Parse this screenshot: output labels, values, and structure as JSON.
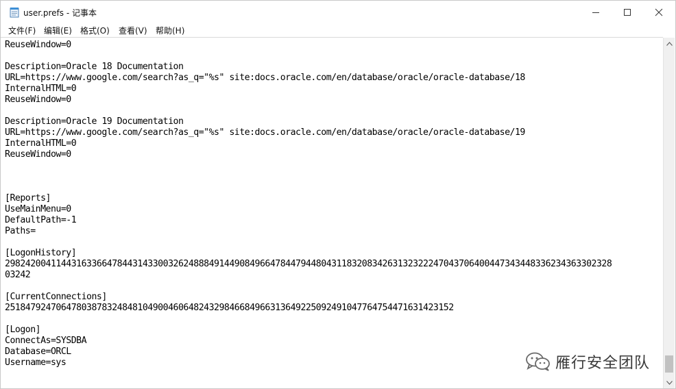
{
  "window": {
    "title": "user.prefs - 记事本"
  },
  "menu": [
    "文件(F)",
    "编辑(E)",
    "格式(O)",
    "查看(V)",
    "帮助(H)"
  ],
  "document_lines": [
    "ReuseWindow=0",
    "",
    "Description=Oracle 18 Documentation",
    "URL=https://www.google.com/search?as_q=\"%s\" site:docs.oracle.com/en/database/oracle/oracle-database/18",
    "InternalHTML=0",
    "ReuseWindow=0",
    "",
    "Description=Oracle 19 Documentation",
    "URL=https://www.google.com/search?as_q=\"%s\" site:docs.oracle.com/en/database/oracle/oracle-database/19",
    "InternalHTML=0",
    "ReuseWindow=0",
    "",
    "",
    "",
    "[Reports]",
    "UseMainMenu=0",
    "DefaultPath=-1",
    "Paths=",
    "",
    "[LogonHistory]",
    "2982420041144316336647844314330032624888491449084966478447944804311832083426313232224704370640044734344833623436330232​8",
    "03242",
    "",
    "[CurrentConnections]",
    "251847924706478038783248481049004606482432984668496631364922509249104776475447163142315​2",
    "",
    "[Logon]",
    "ConnectAs=SYSDBA",
    "Database=ORCL",
    "Username=sys"
  ],
  "watermark": {
    "text": "雁行安全团队",
    "icon": "wechat-icon"
  },
  "icons": {
    "app": "notepad-icon",
    "minimize": "minimize-icon",
    "maximize": "maximize-icon",
    "close": "close-icon",
    "scroll_up": "scroll-up-arrow-icon",
    "scroll_down": "scroll-down-arrow-icon"
  }
}
